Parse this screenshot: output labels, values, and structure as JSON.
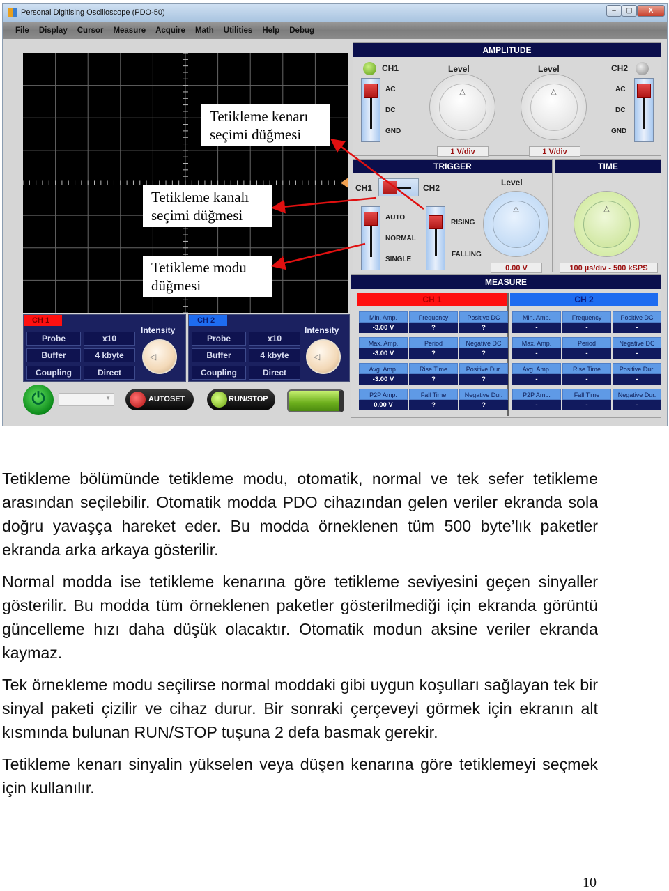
{
  "window": {
    "title": "Personal Digitising Oscilloscope (PDO-50)",
    "controls": {
      "minimize": "–",
      "maximize": "▢",
      "close": "X"
    }
  },
  "menu": [
    "File",
    "Display",
    "Cursor",
    "Measure",
    "Acquire",
    "Math",
    "Utilities",
    "Help",
    "Debug"
  ],
  "callouts": {
    "edge": [
      "Tetikleme kenarı",
      "seçimi düğmesi"
    ],
    "channel": [
      "Tetikleme kanalı",
      "seçimi düğmesi"
    ],
    "mode": [
      "Tetikleme modu",
      "düğmesi"
    ]
  },
  "channel_panels": [
    {
      "tag": "CH 1",
      "tag_color": "#ff1010",
      "intensity": "Intensity",
      "rows": [
        [
          "Probe",
          "x10"
        ],
        [
          "Buffer",
          "4 kbyte"
        ],
        [
          "Coupling",
          "Direct"
        ]
      ]
    },
    {
      "tag": "CH 2",
      "tag_color": "#1e6cf0",
      "intensity": "Intensity",
      "rows": [
        [
          "Probe",
          "x10"
        ],
        [
          "Buffer",
          "4 kbyte"
        ],
        [
          "Coupling",
          "Direct"
        ]
      ]
    }
  ],
  "bottom": {
    "autoset": "AUTOSET",
    "runstop": "RUN/STOP",
    "dropdown_value": ""
  },
  "amplitude": {
    "title": "AMPLITUDE",
    "ch1": "CH1",
    "ch2": "CH2",
    "coupling": [
      "AC",
      "DC",
      "GND"
    ],
    "level": "Level",
    "ch1_scale": "1 V/div",
    "ch2_scale": "1 V/div",
    "ch1_led": "on",
    "ch2_led": "off"
  },
  "trigger": {
    "title": "TRIGGER",
    "ch1": "CH1",
    "ch2": "CH2",
    "modes": [
      "AUTO",
      "NORMAL",
      "SINGLE"
    ],
    "edges": [
      "RISING",
      "FALLING"
    ],
    "level": "Level",
    "level_value": "0.00 V"
  },
  "time": {
    "title": "TIME",
    "value": "100 µs/div - 500 kSPS"
  },
  "measure": {
    "title": "MEASURE",
    "channels": [
      {
        "name": "CH 1",
        "color": "#ff1010",
        "cells": [
          [
            "Min. Amp.",
            "-3.00 V"
          ],
          [
            "Frequency",
            "?"
          ],
          [
            "Positive DC",
            "?"
          ],
          [
            "Max. Amp.",
            "-3.00 V"
          ],
          [
            "Period",
            "?"
          ],
          [
            "Negative DC",
            "?"
          ],
          [
            "Avg. Amp.",
            "-3.00 V"
          ],
          [
            "Rise Time",
            "?"
          ],
          [
            "Positive Dur.",
            "?"
          ],
          [
            "P2P Amp.",
            "0.00 V"
          ],
          [
            "Fall Time",
            "?"
          ],
          [
            "Negative Dur.",
            "?"
          ]
        ]
      },
      {
        "name": "CH 2",
        "color": "#1e6cf0",
        "cells": [
          [
            "Min. Amp.",
            "-"
          ],
          [
            "Frequency",
            "-"
          ],
          [
            "Positive DC",
            "-"
          ],
          [
            "Max. Amp.",
            "-"
          ],
          [
            "Period",
            "-"
          ],
          [
            "Negative DC",
            "-"
          ],
          [
            "Avg. Amp.",
            "-"
          ],
          [
            "Rise Time",
            "-"
          ],
          [
            "Positive Dur.",
            "-"
          ],
          [
            "P2P Amp.",
            "-"
          ],
          [
            "Fall Time",
            "-"
          ],
          [
            "Negative Dur.",
            "-"
          ]
        ]
      }
    ]
  },
  "paragraphs": [
    "Tetikleme bölümünde tetikleme modu, otomatik, normal ve tek sefer tetikleme arasından seçilebilir. Otomatik modda PDO cihazından gelen veriler ekranda sola doğru yavaşça hareket eder. Bu modda örneklenen tüm 500 byte’lık paketler ekranda arka arkaya gösterilir.",
    "Normal modda ise tetikleme kenarına göre tetikleme seviyesini geçen sinyaller gösterilir. Bu modda tüm örneklenen paketler gösterilmediği için ekranda görüntü güncelleme hızı daha düşük olacaktır. Otomatik modun aksine veriler ekranda kaymaz.",
    "Tek örnekleme modu seçilirse normal moddaki gibi uygun koşulları sağlayan tek bir sinyal paketi çizilir ve cihaz durur. Bir sonraki çerçeveyi görmek için ekranın alt kısmında bulunan RUN/STOP tuşuna 2 defa basmak gerekir.",
    "Tetikleme kenarı sinyalin yükselen veya düşen kenarına göre tetiklemeyi seçmek için kullanılır."
  ],
  "page_number": "10"
}
